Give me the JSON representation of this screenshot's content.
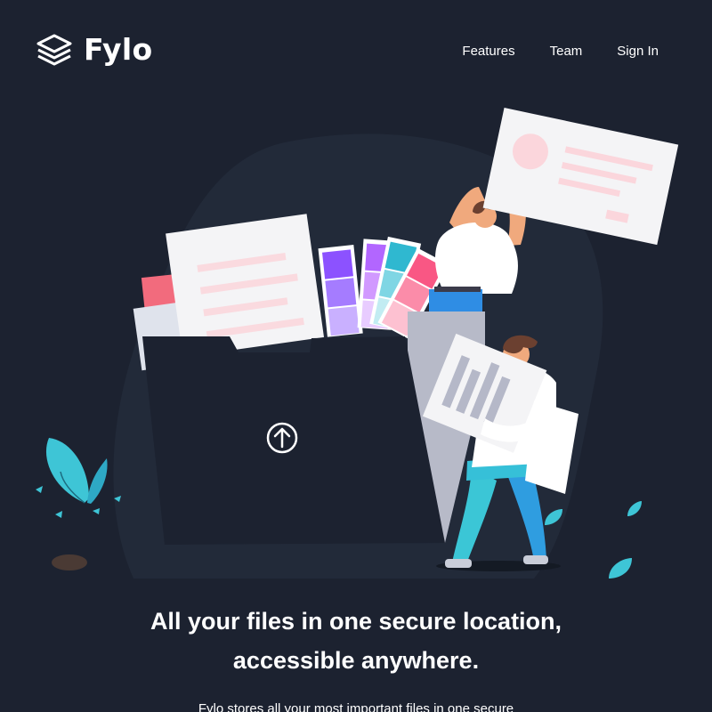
{
  "brand": {
    "name": "Fylo",
    "logo_icon": "stacked-layers-icon"
  },
  "nav": {
    "items": [
      {
        "label": "Features"
      },
      {
        "label": "Team"
      },
      {
        "label": "Sign In"
      }
    ]
  },
  "hero": {
    "illustration": "people-uploading-files-to-folder",
    "upload_icon": "arrow-up-circle-icon",
    "headline_line1": "All your files in one secure location,",
    "headline_line2": "accessible anywhere.",
    "subtext": "Fylo stores all your most important files in one secure"
  },
  "colors": {
    "background": "#1c2230",
    "text": "#ffffff",
    "accent_cyan": "#3ec5d6",
    "accent_pink": "#fa6f8a"
  }
}
